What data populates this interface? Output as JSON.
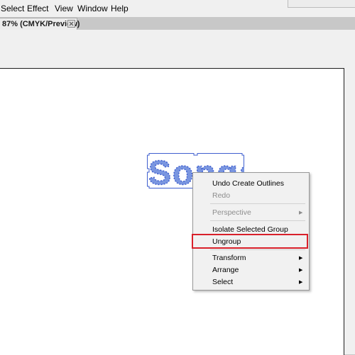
{
  "menubar": {
    "items": [
      "Select",
      "Effect",
      "View",
      "Window",
      "Help"
    ]
  },
  "document_tab": {
    "label": "87% (CMYK/Preview)",
    "close_icon": "close-icon"
  },
  "artwork": {
    "text": "Songs",
    "fill": "#7a96e0",
    "outline": "#3f5fcf",
    "anchor_color": "#3f5fcf",
    "selection_color": "#3f5fcf"
  },
  "context_menu": {
    "undo": "Undo Create Outlines",
    "redo": "Redo",
    "perspective": "Perspective",
    "isolate": "Isolate Selected Group",
    "ungroup": "Ungroup",
    "transform": "Transform",
    "arrange": "Arrange",
    "select": "Select",
    "submenu_icon": "submenu-arrow-icon",
    "highlight_color": "#d9202a"
  }
}
